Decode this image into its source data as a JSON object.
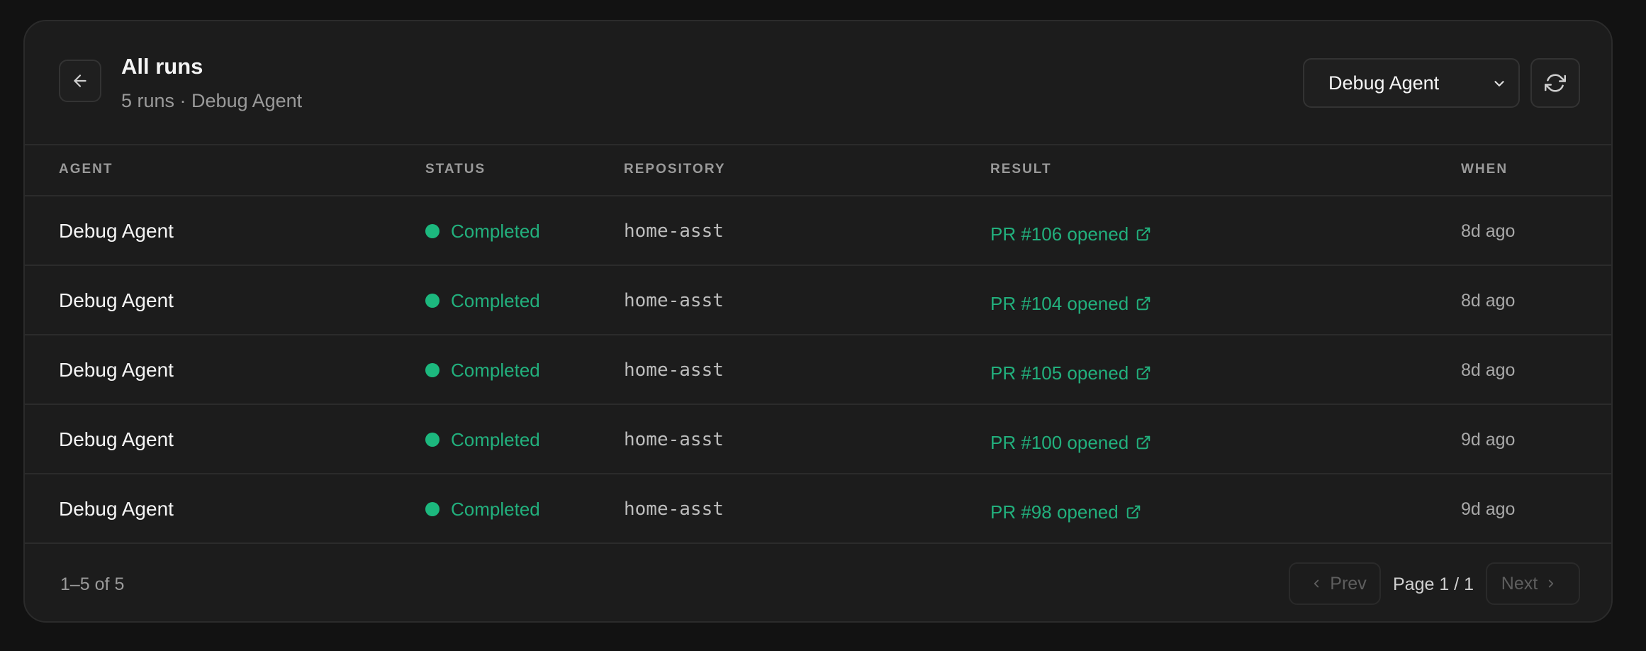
{
  "header": {
    "title": "All runs",
    "subtitle": "5 runs · Debug Agent",
    "agent_filter": "Debug Agent"
  },
  "columns": {
    "agent": "AGENT",
    "status": "STATUS",
    "repository": "REPOSITORY",
    "result": "RESULT",
    "when": "WHEN"
  },
  "rows": [
    {
      "agent": "Debug Agent",
      "status": "Completed",
      "repository": "home-asst",
      "result": "PR #106 opened",
      "when": "8d ago"
    },
    {
      "agent": "Debug Agent",
      "status": "Completed",
      "repository": "home-asst",
      "result": "PR #104 opened",
      "when": "8d ago"
    },
    {
      "agent": "Debug Agent",
      "status": "Completed",
      "repository": "home-asst",
      "result": "PR #105 opened",
      "when": "8d ago"
    },
    {
      "agent": "Debug Agent",
      "status": "Completed",
      "repository": "home-asst",
      "result": "PR #100 opened",
      "when": "9d ago"
    },
    {
      "agent": "Debug Agent",
      "status": "Completed",
      "repository": "home-asst",
      "result": "PR #98 opened",
      "when": "9d ago"
    }
  ],
  "footer": {
    "count": "1–5 of 5",
    "prev_label": "Prev",
    "page_label": "Page 1 / 1",
    "next_label": "Next"
  },
  "colors": {
    "background": "#121212",
    "panel": "#1c1c1c",
    "accent_green": "#22b07d",
    "status_dot": "#1cb87e"
  },
  "icons": {
    "back": "arrow-left-icon",
    "dropdown": "chevron-down-icon",
    "refresh": "refresh-icon",
    "status": "status-dot",
    "external": "external-link-icon",
    "prev": "chevron-left-icon",
    "next": "chevron-right-icon"
  }
}
